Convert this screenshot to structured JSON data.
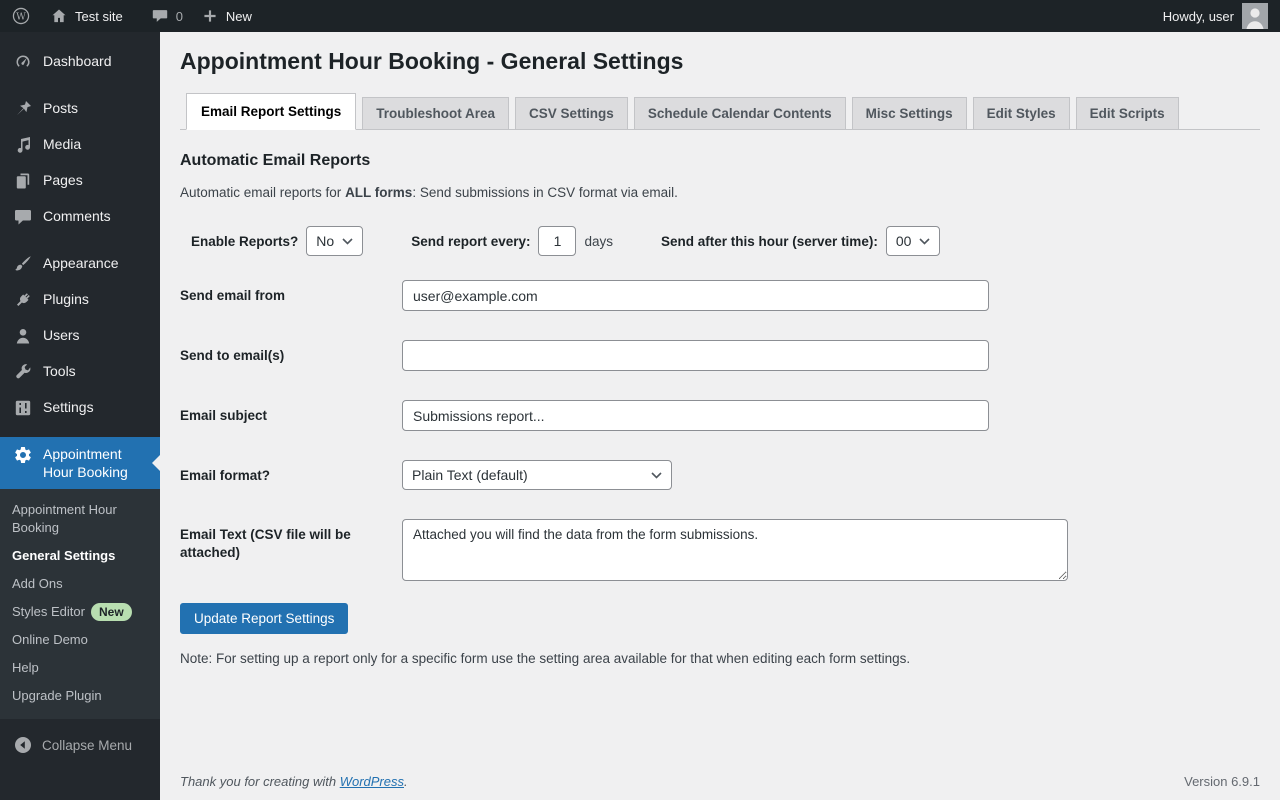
{
  "admin_bar": {
    "site_name": "Test site",
    "comments_count": "0",
    "new_label": "New",
    "howdy": "Howdy, user"
  },
  "sidebar": {
    "items": [
      {
        "label": "Dashboard"
      },
      {
        "label": "Posts"
      },
      {
        "label": "Media"
      },
      {
        "label": "Pages"
      },
      {
        "label": "Comments"
      },
      {
        "label": "Appearance"
      },
      {
        "label": "Plugins"
      },
      {
        "label": "Users"
      },
      {
        "label": "Tools"
      },
      {
        "label": "Settings"
      },
      {
        "label": "Appointment Hour Booking"
      }
    ],
    "submenu": [
      {
        "label": "Appointment Hour Booking"
      },
      {
        "label": "General Settings",
        "current": true
      },
      {
        "label": "Add Ons"
      },
      {
        "label": "Styles Editor",
        "badge": "New"
      },
      {
        "label": "Online Demo"
      },
      {
        "label": "Help"
      },
      {
        "label": "Upgrade Plugin"
      }
    ],
    "collapse_label": "Collapse Menu"
  },
  "page": {
    "title": "Appointment Hour Booking - General Settings",
    "tabs": [
      {
        "label": "Email Report Settings",
        "active": true
      },
      {
        "label": "Troubleshoot Area"
      },
      {
        "label": "CSV Settings"
      },
      {
        "label": "Schedule Calendar Contents"
      },
      {
        "label": "Misc Settings"
      },
      {
        "label": "Edit Styles"
      },
      {
        "label": "Edit Scripts"
      }
    ],
    "section_title": "Automatic Email Reports",
    "intro_prefix": "Automatic email reports for ",
    "intro_bold": "ALL forms",
    "intro_suffix": ": Send submissions in CSV format via email.",
    "fields": {
      "enable_reports_label": "Enable Reports?",
      "enable_reports_value": "No",
      "send_every_label": "Send report every:",
      "send_every_value": "1",
      "send_every_suffix": "days",
      "send_hour_label": "Send after this hour (server time):",
      "send_hour_value": "00",
      "email_from_label": "Send email from",
      "email_from_value": "user@example.com",
      "email_to_label": "Send to email(s)",
      "email_to_value": "",
      "subject_label": "Email subject",
      "subject_value": "Submissions report...",
      "format_label": "Email format?",
      "format_value": "Plain Text (default)",
      "email_text_label": "Email Text (CSV file will be attached)",
      "email_text_value": "Attached you will find the data from the form submissions."
    },
    "update_button": "Update Report Settings",
    "note": "Note: For setting up a report only for a specific form use the setting area available for that when editing each form settings."
  },
  "footer": {
    "thanks_prefix": "Thank you for creating with ",
    "wordpress_link": "WordPress",
    "thanks_suffix": ".",
    "version": "Version 6.9.1"
  },
  "colors": {
    "accent_blue": "#2271b1",
    "admin_bar_bg": "#1d2327",
    "menu_bg": "#23282d",
    "submenu_bg": "#2c3338",
    "content_bg": "#f0f0f1",
    "active_tab_bg": "#ffffff",
    "inactive_tab_bg": "#dcdcde",
    "badge_bg": "#b8deb0"
  }
}
